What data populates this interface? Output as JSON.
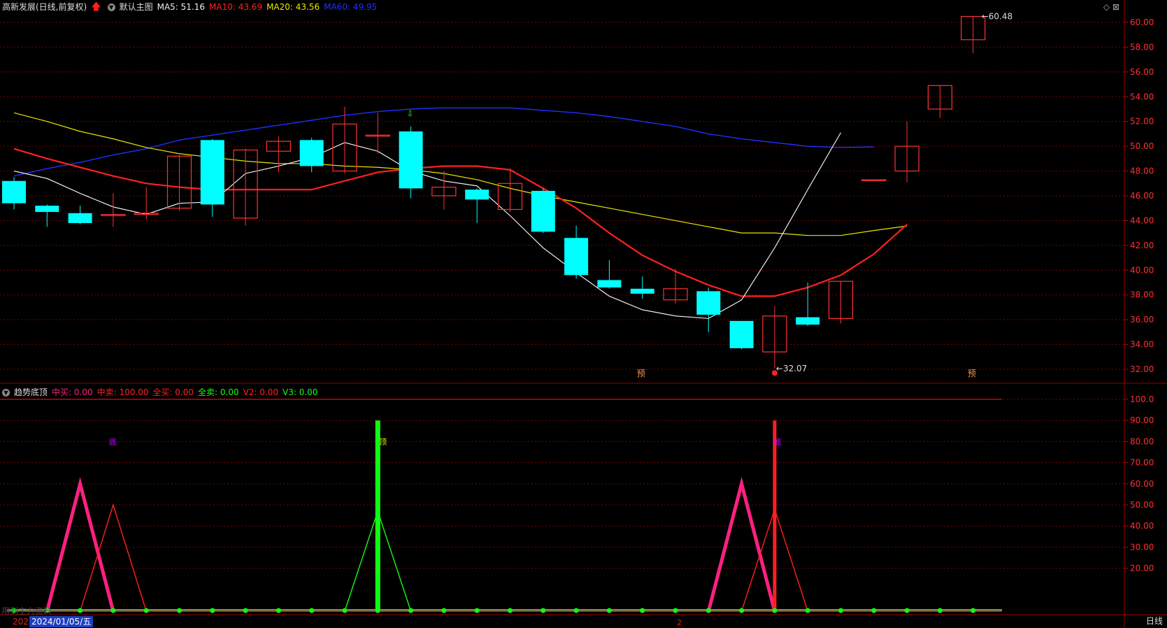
{
  "main_header": {
    "stock": "高新发展(日线,前复权)",
    "template": "默认主图",
    "ma5": "MA5: 51.16",
    "ma10": "MA10: 43.69",
    "ma20": "MA20: 43.56",
    "ma60": "MA60: 49.95"
  },
  "ind_header": {
    "title": "趋势底顶",
    "v1": "中买: 0.00",
    "v2": "中卖: 100.00",
    "v3": "全买: 0.00",
    "v4": "全卖: 0.00",
    "v5": "V2: 0.00",
    "v6": "V3: 0.00"
  },
  "colors": {
    "up": "#ff3333",
    "down": "#00ffff",
    "ma5": "#ffffff",
    "ma10": "#ff2020",
    "ma20": "#e8e800",
    "ma60": "#2030ff",
    "pink": "#ff2080",
    "green": "#10ff10",
    "grid": "#7a0000"
  },
  "price_axis": [
    "60.00",
    "58.00",
    "56.00",
    "54.00",
    "52.00",
    "50.00",
    "48.00",
    "46.00",
    "44.00",
    "42.00",
    "40.00",
    "38.00",
    "36.00",
    "34.00",
    "32.00"
  ],
  "ind_axis": [
    "100.0",
    "90.00",
    "80.00",
    "70.00",
    "60.00",
    "50.00",
    "40.00",
    "30.00",
    "20.00"
  ],
  "chart_data": {
    "type": "candlestick",
    "candles": [
      {
        "o": 47.2,
        "c": 45.4,
        "h": 47.5,
        "l": 44.9
      },
      {
        "o": 45.2,
        "c": 44.7,
        "h": 45.3,
        "l": 43.5
      },
      {
        "o": 44.6,
        "c": 43.8,
        "h": 45.2,
        "l": 43.7
      },
      {
        "o": 44.4,
        "c": 44.5,
        "h": 46.2,
        "l": 43.5
      },
      {
        "o": 44.5,
        "c": 44.6,
        "h": 46.7,
        "l": 44.1
      },
      {
        "o": 45.0,
        "c": 49.2,
        "h": 49.3,
        "l": 44.8
      },
      {
        "o": 50.5,
        "c": 45.3,
        "h": 50.6,
        "l": 44.3
      },
      {
        "o": 44.2,
        "c": 49.7,
        "h": 49.8,
        "l": 43.6
      },
      {
        "o": 49.6,
        "c": 50.4,
        "h": 50.8,
        "l": 47.9
      },
      {
        "o": 50.5,
        "c": 48.4,
        "h": 50.7,
        "l": 47.9
      },
      {
        "o": 48.0,
        "c": 51.8,
        "h": 53.2,
        "l": 47.8
      },
      {
        "o": 50.9,
        "c": 50.9,
        "h": 52.7,
        "l": 49.4
      },
      {
        "o": 51.2,
        "c": 46.6,
        "h": 51.6,
        "l": 45.8
      },
      {
        "o": 46.0,
        "c": 46.7,
        "h": 48.0,
        "l": 44.9
      },
      {
        "o": 46.5,
        "c": 45.7,
        "h": 46.6,
        "l": 43.8
      },
      {
        "o": 44.9,
        "c": 47.0,
        "h": 48.2,
        "l": 44.7
      },
      {
        "o": 46.4,
        "c": 43.1,
        "h": 46.6,
        "l": 43.0
      },
      {
        "o": 42.6,
        "c": 39.6,
        "h": 43.6,
        "l": 39.3
      },
      {
        "o": 39.2,
        "c": 38.6,
        "h": 40.8,
        "l": 38.5
      },
      {
        "o": 38.5,
        "c": 38.1,
        "h": 39.5,
        "l": 37.7
      },
      {
        "o": 37.6,
        "c": 38.5,
        "h": 40.1,
        "l": 37.3
      },
      {
        "o": 38.3,
        "c": 36.4,
        "h": 38.6,
        "l": 35.0
      },
      {
        "o": 35.9,
        "c": 33.7,
        "h": 35.9,
        "l": 33.6
      },
      {
        "o": 33.4,
        "c": 36.3,
        "h": 37.1,
        "l": 32.07
      },
      {
        "o": 36.2,
        "c": 35.6,
        "h": 39.0,
        "l": 35.5
      },
      {
        "o": 36.1,
        "c": 39.1,
        "h": 39.1,
        "l": 35.7
      },
      {
        "o": 47.3,
        "c": 47.3,
        "h": 47.3,
        "l": 47.3
      },
      {
        "o": 48.0,
        "c": 50.0,
        "h": 52.0,
        "l": 47.1
      },
      {
        "o": 53.0,
        "c": 54.9,
        "h": 54.9,
        "l": 52.3
      },
      {
        "o": 58.6,
        "c": 60.48,
        "h": 60.48,
        "l": 57.5
      }
    ],
    "ma5": [
      48.0,
      47.4,
      46.2,
      45.1,
      44.5,
      45.4,
      45.5,
      47.8,
      48.4,
      49.1,
      50.3,
      49.6,
      48.0,
      47.2,
      46.8,
      44.4,
      41.8,
      39.8,
      37.9,
      36.8,
      36.3,
      36.1,
      37.6,
      41.8,
      46.5,
      51.1
    ],
    "ma10": [
      49.8,
      49.0,
      48.3,
      47.6,
      47.0,
      46.7,
      46.5,
      46.5,
      46.5,
      46.5,
      47.2,
      47.9,
      48.2,
      48.4,
      48.4,
      48.1,
      46.6,
      45.0,
      43.0,
      41.2,
      39.9,
      38.8,
      37.9,
      37.9,
      38.6,
      39.6,
      41.3,
      43.69
    ],
    "ma20": [
      52.7,
      52.0,
      51.2,
      50.6,
      49.9,
      49.4,
      49.1,
      48.8,
      48.6,
      48.6,
      48.4,
      48.3,
      48.1,
      47.8,
      47.3,
      46.6,
      46.0,
      45.5,
      45.0,
      44.5,
      44.0,
      43.5,
      43.0,
      43.0,
      42.8,
      42.8,
      43.2,
      43.56
    ],
    "ma60": [
      47.6,
      48.2,
      48.7,
      49.3,
      49.8,
      50.5,
      50.9,
      51.3,
      51.7,
      52.1,
      52.5,
      52.8,
      53.0,
      53.1,
      53.1,
      53.1,
      52.9,
      52.7,
      52.4,
      52.0,
      51.6,
      51.0,
      50.6,
      50.3,
      50.0,
      49.9,
      49.95
    ],
    "price_annotations": [
      "60.48",
      "32.07"
    ],
    "signal_labels": [
      "预",
      "预",
      "底",
      "顶",
      "底"
    ]
  },
  "date_label": "2024/01/05/五",
  "year_label": "202",
  "mark_label": "2",
  "watermark": "用到主力资料",
  "bottom_tab": "日线",
  "corner_icons": "◇ ⊠"
}
